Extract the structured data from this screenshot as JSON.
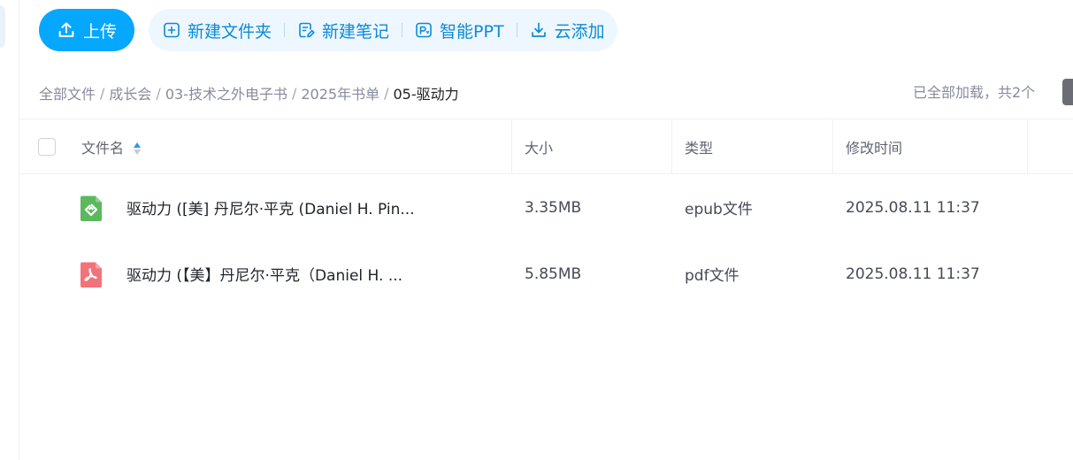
{
  "toolbar": {
    "upload_label": "上传",
    "actions": [
      {
        "label": "新建文件夹",
        "icon": "folder-add-icon"
      },
      {
        "label": "新建笔记",
        "icon": "note-edit-icon"
      },
      {
        "label": "智能PPT",
        "icon": "smart-ppt-icon"
      },
      {
        "label": "云添加",
        "icon": "cloud-download-icon"
      }
    ],
    "accent": "#06a7ff"
  },
  "breadcrumb": {
    "items": [
      "全部文件",
      "成长会",
      "03-技术之外电子书",
      "2025年书单",
      "05-驱动力"
    ],
    "separator": "/"
  },
  "status": {
    "load_text": "已全部加载，共2个"
  },
  "table": {
    "columns": [
      "文件名",
      "大小",
      "类型",
      "修改时间"
    ],
    "rows": [
      {
        "name": "驱动力 ([美] 丹尼尔·平克 (Daniel H. Pin...",
        "size": "3.35MB",
        "type": "epub文件",
        "modified": "2025.08.11 11:37",
        "icon": "epub-file-icon",
        "icon_color": "#5cb85c"
      },
      {
        "name": "驱动力 (【美】丹尼尔·平克（Daniel H. ...",
        "size": "5.85MB",
        "type": "pdf文件",
        "modified": "2025.08.11 11:37",
        "icon": "pdf-file-icon",
        "icon_color": "#f2727a"
      }
    ]
  }
}
